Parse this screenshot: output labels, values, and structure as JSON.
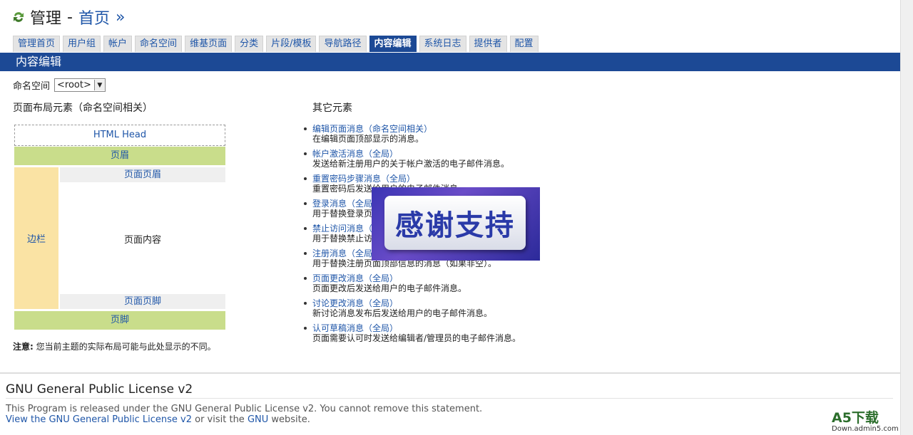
{
  "title": {
    "main": "管理",
    "separator": "-",
    "link": "首页",
    "arrow": "»"
  },
  "tabs": [
    {
      "label": "管理首页"
    },
    {
      "label": "用户组"
    },
    {
      "label": "帐户"
    },
    {
      "label": "命名空间"
    },
    {
      "label": "维基页面"
    },
    {
      "label": "分类"
    },
    {
      "label": "片段/模板"
    },
    {
      "label": "导航路径"
    },
    {
      "label": "内容编辑",
      "active": true
    },
    {
      "label": "系统日志"
    },
    {
      "label": "提供者"
    },
    {
      "label": "配置"
    }
  ],
  "section_title": "内容编辑",
  "namespace": {
    "label": "命名空间",
    "selected": "<root>"
  },
  "left_heading": "页面布局元素（命名空间相关）",
  "right_heading": "其它元素",
  "layout": {
    "html_head": "HTML Head",
    "header": "页眉",
    "sidebar": "边栏",
    "page_header": "页面页眉",
    "page_content": "页面内容",
    "page_footer": "页面页脚",
    "footer": "页脚"
  },
  "note": {
    "label": "注意:",
    "text": "您当前主题的实际布局可能与此处显示的不同。"
  },
  "elements": [
    {
      "title": "编辑页面消息（命名空间相关）",
      "desc": "在编辑页面顶部显示的消息。"
    },
    {
      "title": "帐户激活消息（全局）",
      "desc": "发送给新注册用户的关于帐户激活的电子邮件消息。"
    },
    {
      "title": "重置密码步骤消息（全局）",
      "desc": "重置密码后发送给用户的电子邮件消息。"
    },
    {
      "title": "登录消息（全局）",
      "desc": "用于替换登录页面顶部信息的消息（如果非空）。"
    },
    {
      "title": "禁止访问消息（全局）",
      "desc": "用于替换禁止访问页面顶部信息的消息（如果非空）。"
    },
    {
      "title": "注册消息（全局）",
      "desc": "用于替换注册页面顶部信息的消息（如果非空）。"
    },
    {
      "title": "页面更改消息（全局）",
      "desc": "页面更改后发送给用户的电子邮件消息。"
    },
    {
      "title": "讨论更改消息（全局）",
      "desc": "新讨论消息发布后发送给用户的电子邮件消息。"
    },
    {
      "title": "认可草稿消息（全局）",
      "desc": "页面需要认可时发送给编辑者/管理员的电子邮件消息。"
    }
  ],
  "watermark": {
    "text": "感谢支持"
  },
  "footer": {
    "title": "GNU General Public License v2",
    "line1": "This Program is released under the GNU General Public License v2. You cannot remove this statement.",
    "link1": "View the GNU General Public License v2",
    "mid": " or visit the ",
    "link2": "GNU",
    "end": " website."
  },
  "brand": {
    "name": "A5下载",
    "url": "Down.admin5.com"
  },
  "colors": {
    "accent": "#1c4995",
    "link": "#1f56a8",
    "header_green": "#c9dd8b",
    "sidebar_yellow": "#fae3a4"
  }
}
